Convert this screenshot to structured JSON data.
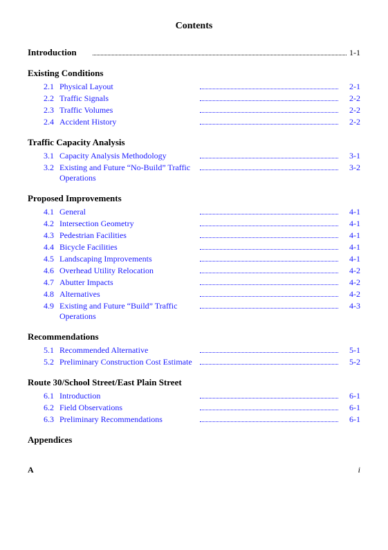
{
  "title": "Contents",
  "intro": {
    "label": "Introduction",
    "dots": true,
    "page": "1-1"
  },
  "sections": [
    {
      "heading": "Existing Conditions",
      "entries": [
        {
          "number": "2.1",
          "label": "Physical Layout",
          "page": "2-1"
        },
        {
          "number": "2.2",
          "label": "Traffic Signals",
          "page": "2-2"
        },
        {
          "number": "2.3",
          "label": "Traffic Volumes",
          "page": "2-2"
        },
        {
          "number": "2.4",
          "label": "Accident History",
          "page": "2-2"
        }
      ]
    },
    {
      "heading": "Traffic Capacity Analysis",
      "entries": [
        {
          "number": "3.1",
          "label": "Capacity Analysis Methodology",
          "page": "3-1"
        },
        {
          "number": "3.2",
          "label": "Existing and Future “No-Build” Traffic Operations",
          "page": "3-2"
        }
      ]
    },
    {
      "heading": "Proposed Improvements",
      "entries": [
        {
          "number": "4.1",
          "label": "General",
          "page": "4-1"
        },
        {
          "number": "4.2",
          "label": "Intersection Geometry",
          "page": "4-1"
        },
        {
          "number": "4.3",
          "label": "Pedestrian Facilities",
          "page": "4-1"
        },
        {
          "number": "4.4",
          "label": "Bicycle Facilities",
          "page": "4-1"
        },
        {
          "number": "4.5",
          "label": "Landscaping Improvements",
          "page": "4-1"
        },
        {
          "number": "4.6",
          "label": "Overhead Utility Relocation",
          "page": "4-2"
        },
        {
          "number": "4.7",
          "label": "Abutter Impacts",
          "page": "4-2"
        },
        {
          "number": "4.8",
          "label": "Alternatives",
          "page": "4-2"
        },
        {
          "number": "4.9",
          "label": "Existing and Future “Build” Traffic Operations",
          "page": "4-3"
        }
      ]
    },
    {
      "heading": "Recommendations",
      "entries": [
        {
          "number": "5.1",
          "label": "Recommended Alternative",
          "page": "5-1"
        },
        {
          "number": "5.2",
          "label": "Preliminary Construction Cost Estimate",
          "page": "5-2"
        }
      ]
    },
    {
      "heading": "Route 30/School Street/East Plain Street",
      "entries": [
        {
          "number": "6.1",
          "label": "Introduction",
          "page": "6-1"
        },
        {
          "number": "6.2",
          "label": "Field Observations",
          "page": "6-1"
        },
        {
          "number": "6.3",
          "label": "Preliminary Recommendations",
          "page": "6-1"
        }
      ]
    }
  ],
  "appendices": {
    "heading": "Appendices"
  },
  "footer": {
    "left": "A",
    "right": "i"
  }
}
